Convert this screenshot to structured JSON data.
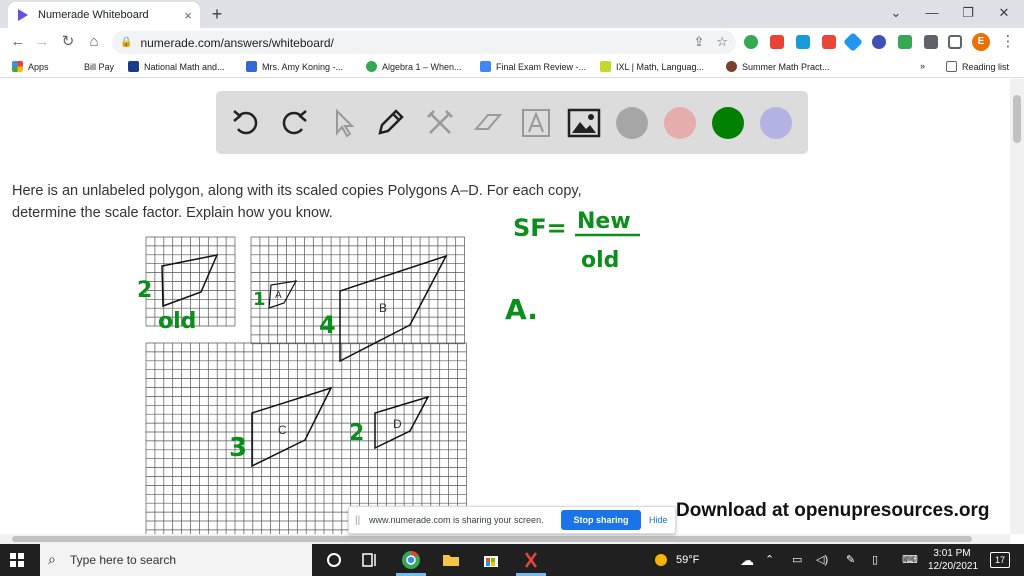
{
  "browser": {
    "tab_title": "Numerade Whiteboard",
    "tab_close": "×",
    "new_tab": "+",
    "url": "numerade.com/answers/whiteboard/",
    "window_controls": {
      "minimize": "—",
      "restore": "❐",
      "close": "✕",
      "collapse": "⌄"
    },
    "profile_initial": "E"
  },
  "bookmarks": [
    {
      "label": "Apps",
      "color": "#e8453c"
    },
    {
      "label": "Bill Pay",
      "color": "#ffffff"
    },
    {
      "label": "National Math and...",
      "color": "#1a3b8a"
    },
    {
      "label": "Mrs. Amy Koning -...",
      "color": "#3367d6"
    },
    {
      "label": "Algebra 1 – When...",
      "color": "#34a853"
    },
    {
      "label": "Final Exam Review -...",
      "color": "#4285f4"
    },
    {
      "label": "IXL | Math, Languag...",
      "color": "#c5d82c"
    },
    {
      "label": "Summer Math Pract...",
      "color": "#7b3f2b"
    }
  ],
  "bookmarks_more": "»",
  "reading_list": "Reading list",
  "whiteboard": {
    "colors": [
      "#a6a6a6",
      "#e6adad",
      "#008000",
      "#b3b3e6"
    ]
  },
  "problem": {
    "line1": "Here is an unlabeled polygon, along with its scaled copies Polygons A–D. For each copy,",
    "line2": "determine the scale factor. Explain how you know."
  },
  "figure": {
    "labels": {
      "a": "A",
      "b": "B",
      "c": "C",
      "d": "D"
    }
  },
  "handwriting": {
    "sf": "SF=",
    "new": "New",
    "old": "old",
    "a_label": "A.",
    "old_label": "old",
    "n2": "2",
    "n1": "1",
    "n4": "4",
    "n3": "3",
    "n2d": "2"
  },
  "share_bar": {
    "message": "www.numerade.com is sharing your screen.",
    "stop": "Stop sharing",
    "hide": "Hide"
  },
  "download": "Download at openupresources.org",
  "taskbar": {
    "search_placeholder": "Type here to search",
    "weather": "59°F",
    "time": "3:01 PM",
    "date": "12/20/2021",
    "notifications": "17"
  }
}
